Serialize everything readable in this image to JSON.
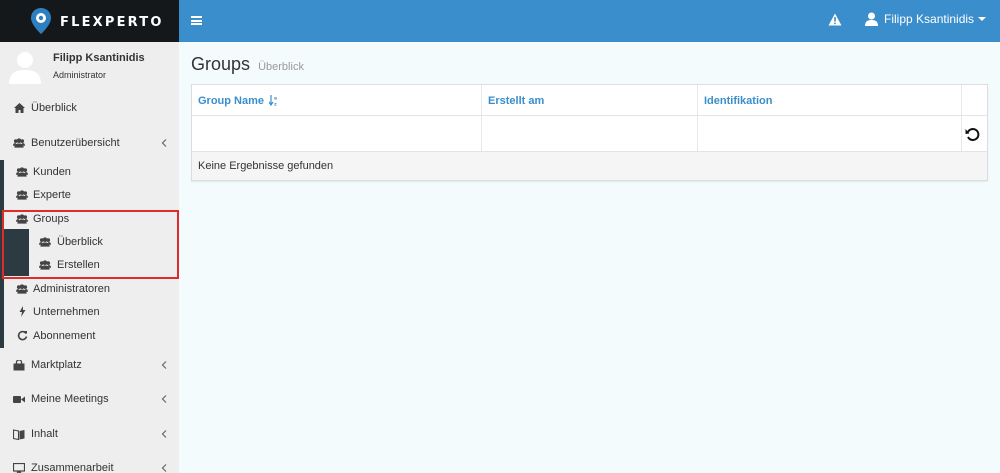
{
  "brand": {
    "name": "FLEXPERTO"
  },
  "topbar": {
    "user_name": "Filipp Ksantinidis"
  },
  "user_panel": {
    "name": "Filipp Ksantinidis",
    "role": "Administrator"
  },
  "sidebar": {
    "overview": "Überblick",
    "benutzer": "Benutzerübersicht",
    "kunden": "Kunden",
    "experte": "Experte",
    "groups": "Groups",
    "groups_overview": "Überblick",
    "groups_create": "Erstellen",
    "administratoren": "Administratoren",
    "unternehmen": "Unternehmen",
    "abonnement": "Abonnement",
    "marktplatz": "Marktplatz",
    "meetings": "Meine Meetings",
    "inhalt": "Inhalt",
    "zusammenarbeit": "Zusammenarbeit"
  },
  "page": {
    "title": "Groups",
    "subtitle": "Überblick"
  },
  "table": {
    "columns": [
      "Group Name",
      "Erstellt am",
      "Identifikation"
    ],
    "empty_text": "Keine Ergebnisse gefunden"
  },
  "colors": {
    "accent": "#3a8ecb",
    "sidebar_bg": "#eeeeee",
    "logo_bg": "#15181a",
    "highlight": "#e02b2b"
  }
}
